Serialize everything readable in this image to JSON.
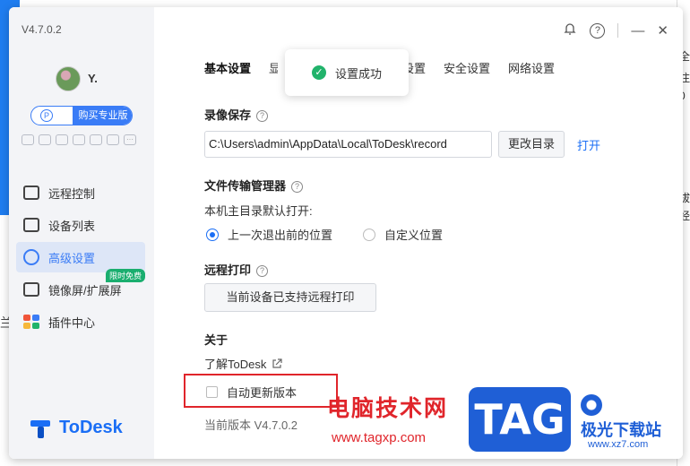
{
  "sidebar": {
    "version": "V4.7.0.2",
    "username": "Y.",
    "pro_button_icon": "P",
    "pro_button_label": "购买专业版",
    "mini_icons": [
      "gamepad-icon",
      "monitor-icon",
      "card-icon",
      "tablet-icon",
      "bulb-icon",
      "window-icon",
      "more-icon"
    ],
    "mini_more": "···",
    "nav": [
      {
        "label": "远程控制",
        "icon": "remote-control-icon"
      },
      {
        "label": "设备列表",
        "icon": "device-list-icon"
      },
      {
        "label": "高级设置",
        "icon": "settings-icon",
        "active": true
      },
      {
        "label": "镜像屏/扩展屏",
        "icon": "mirror-screen-icon",
        "badge": "限时免费"
      },
      {
        "label": "插件中心",
        "icon": "plugin-center-icon"
      }
    ],
    "brand": "ToDesk"
  },
  "header": {
    "icons": [
      "bell-icon",
      "help-icon",
      "minimize-icon",
      "close-icon"
    ],
    "help_glyph": "?",
    "close_glyph": "✕",
    "minimize_glyph": "—"
  },
  "tabs": [
    {
      "label": "基本设置",
      "active": true
    },
    {
      "label": "显",
      "partial": true
    },
    {
      "label": "快捷键设置"
    },
    {
      "label": "安全设置"
    },
    {
      "label": "网络设置"
    }
  ],
  "toast": {
    "check": "✓",
    "text": "设置成功"
  },
  "recording": {
    "title": "录像保存",
    "path": "C:\\Users\\admin\\AppData\\Local\\ToDesk\\record",
    "change_btn": "更改目录",
    "open_link": "打开"
  },
  "file_transfer": {
    "title": "文件传输管理器",
    "label": "本机主目录默认打开:",
    "options": [
      "上一次退出前的位置",
      "自定义位置"
    ],
    "selected": 0
  },
  "remote_print": {
    "title": "远程打印",
    "button": "当前设备已支持远程打印"
  },
  "about": {
    "title": "关于",
    "learn": "了解ToDesk",
    "auto_update": "自动更新版本",
    "auto_update_checked": false,
    "current_version": "当前版本 V4.7.0.2"
  },
  "watermark": {
    "cn": "电脑技术网",
    "url": "www.tagxp.com",
    "tag": "TAG",
    "site": "极光下载站",
    "site_url": "www.xz7.com"
  },
  "background_fragments": {
    "left": "兰",
    "right_lines": [
      "全",
      "注",
      "0",
      "",
      "拔",
      "经"
    ]
  },
  "colors": {
    "accent": "#1a6ef5",
    "success": "#21b36b",
    "highlight": "#e0252b",
    "badge": "#1aae6f"
  }
}
